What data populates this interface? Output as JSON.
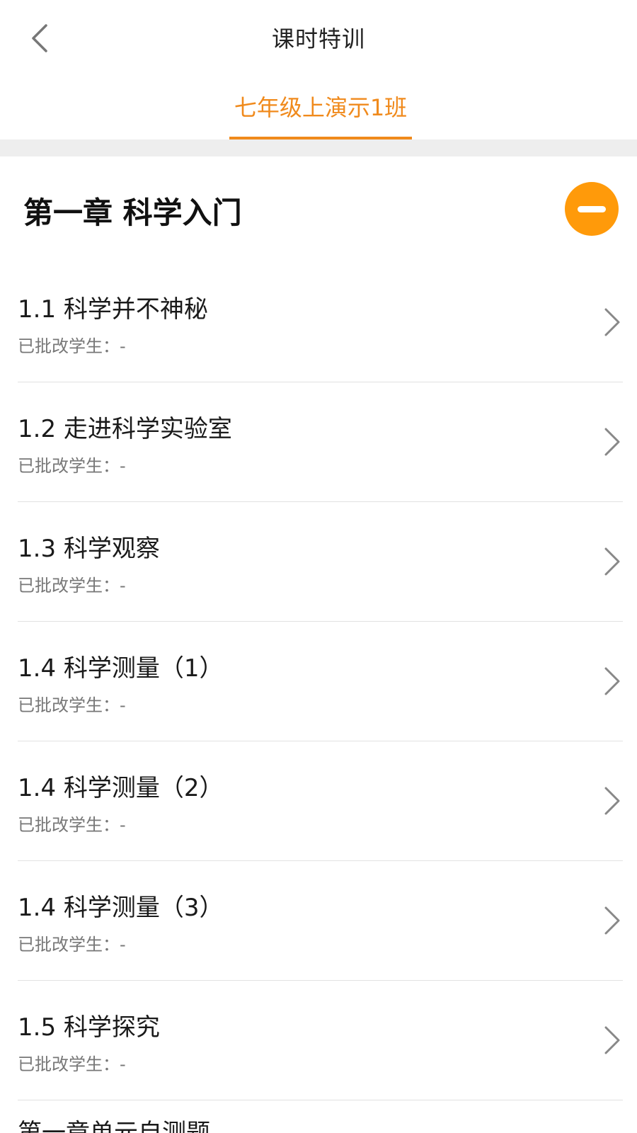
{
  "header": {
    "title": "课时特训",
    "back_icon": "chevron-left-icon"
  },
  "tabs": [
    {
      "label": "七年级上演示1班",
      "active": true
    }
  ],
  "colors": {
    "accent": "#f08a1c",
    "collapse_button": "#ff9a0a",
    "divider": "#e2e2e2",
    "section_gap": "#eeeeee"
  },
  "chapter": {
    "title": "第一章 科学入门",
    "collapse_icon": "minus-circle-icon"
  },
  "lessons": [
    {
      "title": "1.1 科学并不神秘",
      "status": "已批改学生：-"
    },
    {
      "title": "1.2 走进科学实验室",
      "status": "已批改学生：-"
    },
    {
      "title": "1.3 科学观察",
      "status": "已批改学生：-"
    },
    {
      "title": "1.4 科学测量（1）",
      "status": "已批改学生：-"
    },
    {
      "title": "1.4 科学测量（2）",
      "status": "已批改学生：-"
    },
    {
      "title": "1.4 科学测量（3）",
      "status": "已批改学生：-"
    },
    {
      "title": "1.5 科学探究",
      "status": "已批改学生：-"
    }
  ],
  "next_item_peek": "第一章单元自测题"
}
